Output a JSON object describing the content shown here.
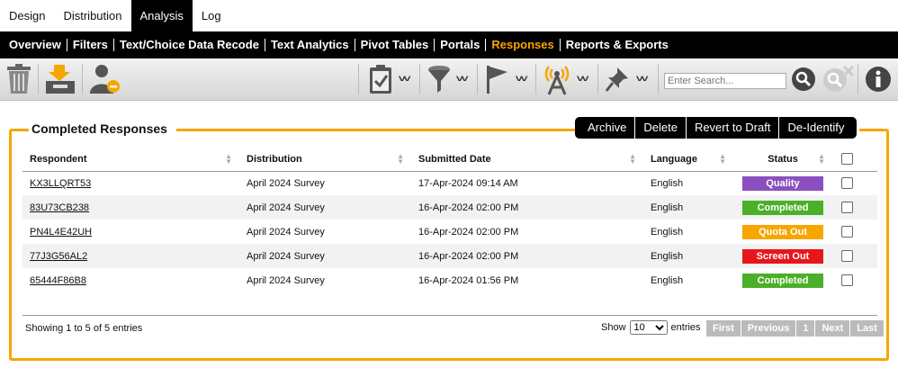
{
  "top_tabs": [
    "Design",
    "Distribution",
    "Analysis",
    "Log"
  ],
  "active_top_tab": "Analysis",
  "subnav": [
    "Overview",
    "Filters",
    "Text/Choice Data Recode",
    "Text Analytics",
    "Pivot Tables",
    "Portals",
    "Responses",
    "Reports & Exports"
  ],
  "active_subnav": "Responses",
  "search": {
    "placeholder": "Enter Search..."
  },
  "panel": {
    "title": "Completed Responses",
    "buttons": [
      "Archive",
      "Delete",
      "Revert to Draft",
      "De-Identify"
    ]
  },
  "table": {
    "headers": [
      "Respondent",
      "Distribution",
      "Submitted Date",
      "Language",
      "Status"
    ],
    "rows": [
      {
        "respondent": "KX3LLQRT53",
        "distribution": "April 2024 Survey",
        "date": "17-Apr-2024 09:14 AM",
        "language": "English",
        "status": "Quality",
        "status_color": "#8b4fbf"
      },
      {
        "respondent": "83U73CB238",
        "distribution": "April 2024 Survey",
        "date": "16-Apr-2024 02:00 PM",
        "language": "English",
        "status": "Completed",
        "status_color": "#4caf2a"
      },
      {
        "respondent": "PN4L4E42UH",
        "distribution": "April 2024 Survey",
        "date": "16-Apr-2024 02:00 PM",
        "language": "English",
        "status": "Quota Out",
        "status_color": "#f7a600"
      },
      {
        "respondent": "77J3G56AL2",
        "distribution": "April 2024 Survey",
        "date": "16-Apr-2024 02:00 PM",
        "language": "English",
        "status": "Screen Out",
        "status_color": "#e8151b"
      },
      {
        "respondent": "65444F86B8",
        "distribution": "April 2024 Survey",
        "date": "16-Apr-2024 01:56 PM",
        "language": "English",
        "status": "Completed",
        "status_color": "#4caf2a"
      }
    ]
  },
  "footer": {
    "showing": "Showing 1 to 5 of 5 entries",
    "show_label": "Show",
    "entries_label": "entries",
    "page_size": "10",
    "pager": [
      "First",
      "Previous",
      "1",
      "Next",
      "Last"
    ]
  },
  "colors": {
    "accent": "#f7a600"
  }
}
